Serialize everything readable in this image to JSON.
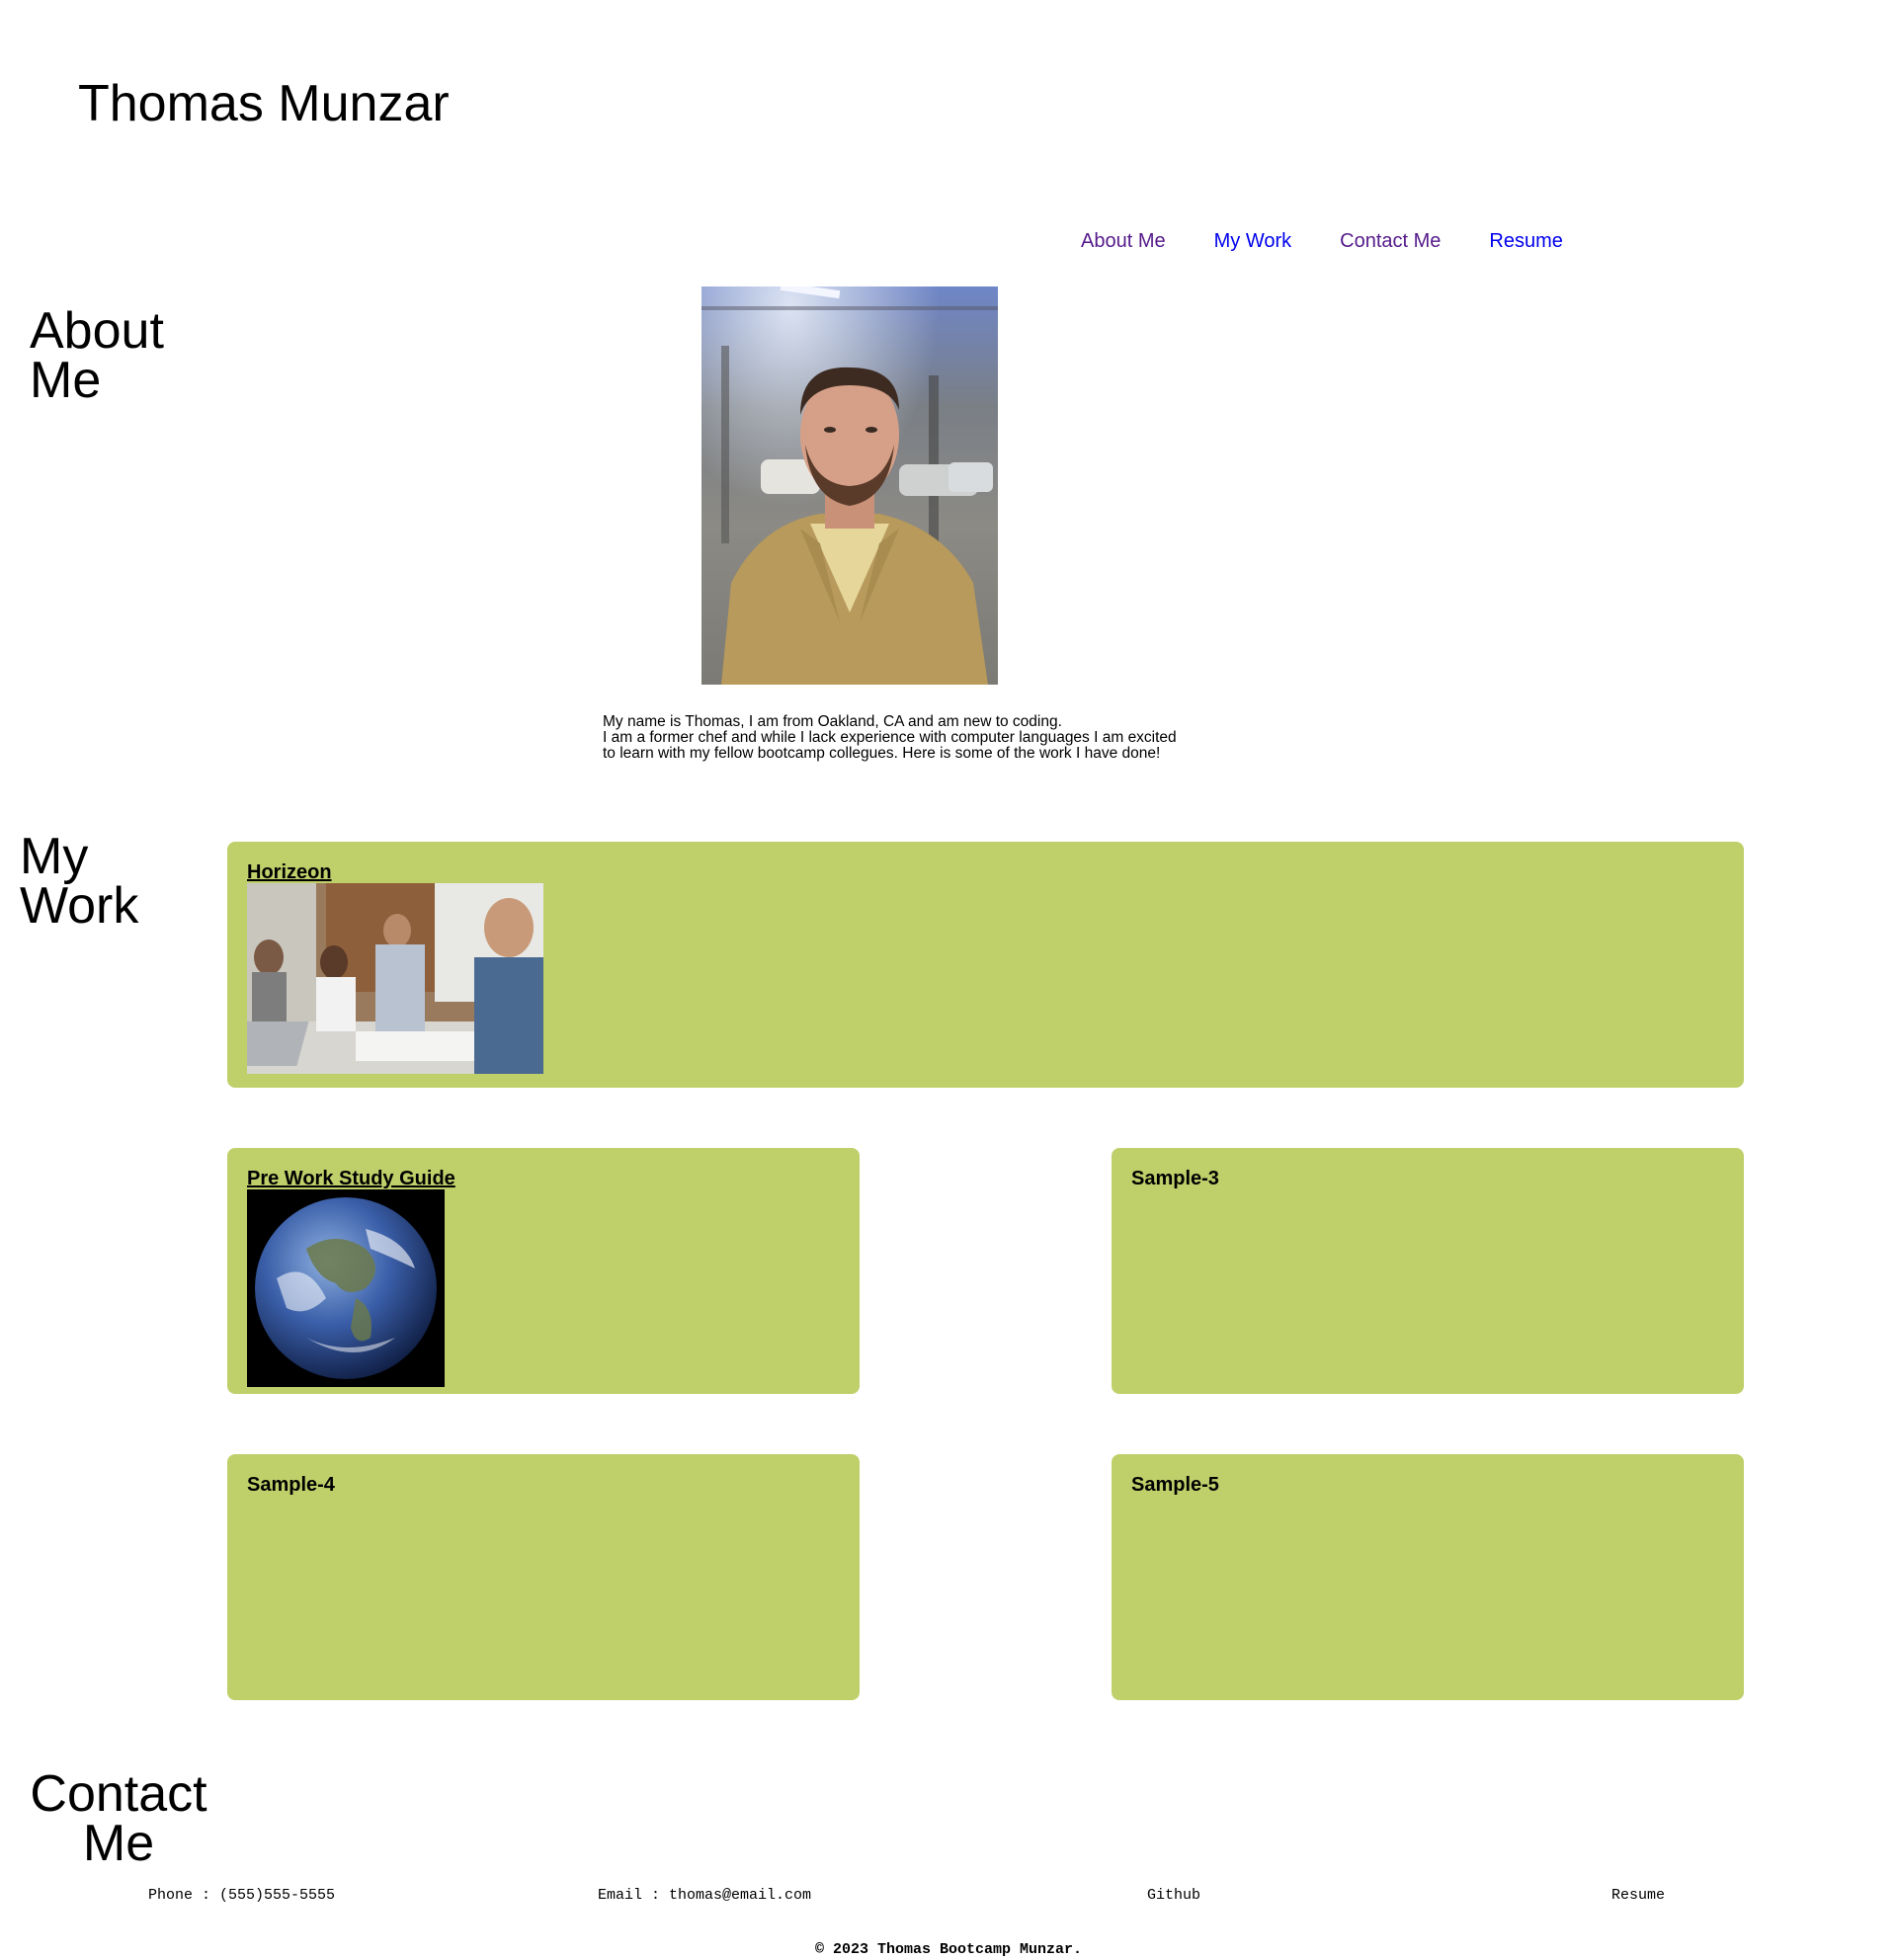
{
  "header": {
    "title": "Thomas Munzar"
  },
  "nav": {
    "items": [
      {
        "label": "About Me",
        "color": "#551a8b"
      },
      {
        "label": "My Work",
        "color": "#0000ee"
      },
      {
        "label": "Contact Me",
        "color": "#551a8b"
      },
      {
        "label": "Resume",
        "color": "#0000ee"
      }
    ]
  },
  "about": {
    "heading": "About Me",
    "heading_lines": [
      "About",
      "Me"
    ],
    "bio_lines": [
      "My name is Thomas, I am from Oakland, CA and am new to coding.",
      "I am a former chef and while I lack experience with computer languages I am excited",
      "to learn with my fellow bootcamp collegues. Here is some of the work I have done!"
    ]
  },
  "work": {
    "heading": "My Work",
    "heading_lines": [
      "My",
      "Work"
    ],
    "projects": [
      {
        "title": "Horizeon",
        "linked": true
      },
      {
        "title": "Pre Work Study Guide",
        "linked": true
      },
      {
        "title": "Sample-3",
        "linked": false
      },
      {
        "title": "Sample-4",
        "linked": false
      },
      {
        "title": "Sample-5",
        "linked": false
      }
    ]
  },
  "contact": {
    "heading": "Contact Me",
    "heading_lines": [
      "Contact",
      "Me"
    ],
    "phone": "Phone : (555)555-5555",
    "email": "Email : thomas@email.com",
    "github": "Github",
    "resume": "Resume"
  },
  "footer": {
    "copyright": "© 2023 Thomas Bootcamp Munzar."
  },
  "colors": {
    "card_background": "#bfd06a",
    "link_visited": "#551a8b",
    "link_unvisited": "#0000ee"
  }
}
